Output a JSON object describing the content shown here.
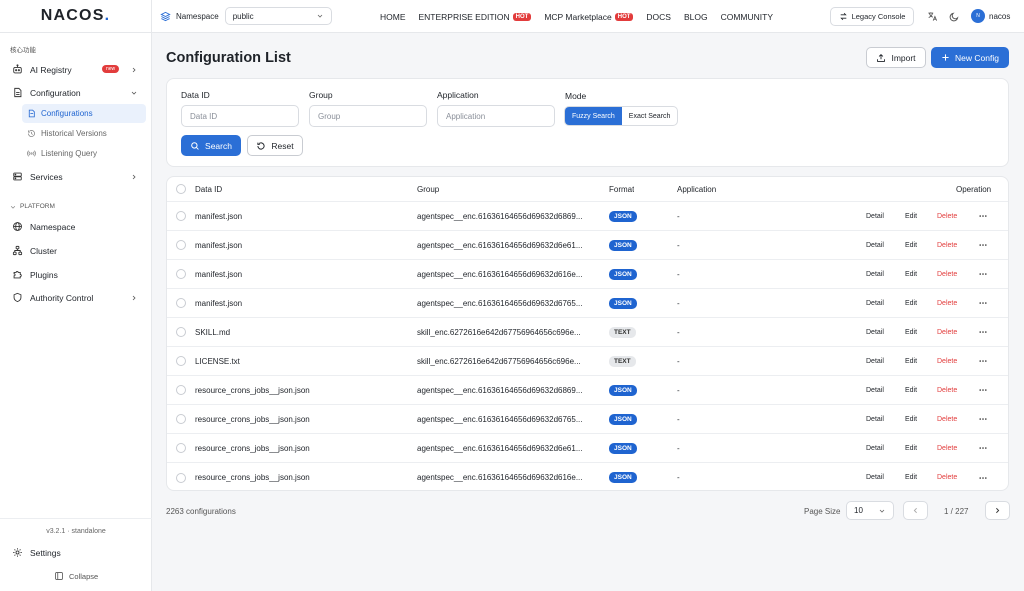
{
  "header": {
    "logo_text": "NACOS",
    "logo_dot": ".",
    "namespace_label": "Namespace",
    "namespace_value": "public",
    "nav": [
      {
        "label": "HOME",
        "hot": ""
      },
      {
        "label": "ENTERPRISE EDITION",
        "hot": "HOT"
      },
      {
        "label": "MCP Marketplace",
        "hot": "HOT"
      },
      {
        "label": "DOCS",
        "hot": ""
      },
      {
        "label": "BLOG",
        "hot": ""
      },
      {
        "label": "COMMUNITY",
        "hot": ""
      }
    ],
    "legacy_console": "Legacy Console",
    "avatar_initial": "N",
    "username": "nacos"
  },
  "sidebar": {
    "section_core": "核心功能",
    "ai_registry": "AI Registry",
    "ai_registry_badge": "new",
    "configuration": "Configuration",
    "configurations": "Configurations",
    "historical_versions": "Historical Versions",
    "listening_query": "Listening Query",
    "services": "Services",
    "section_platform": "PLATFORM",
    "namespace": "Namespace",
    "cluster": "Cluster",
    "plugins": "Plugins",
    "authority_control": "Authority Control",
    "version": "v3.2.1 · standalone",
    "settings": "Settings",
    "collapse": "Collapse"
  },
  "main": {
    "title": "Configuration List",
    "import_label": "Import",
    "new_config_label": "New Config"
  },
  "filters": {
    "data_id_label": "Data ID",
    "data_id_placeholder": "Data ID",
    "group_label": "Group",
    "group_placeholder": "Group",
    "application_label": "Application",
    "application_placeholder": "Application",
    "mode_label": "Mode",
    "fuzzy_search": "Fuzzy Search",
    "exact_search": "Exact Search",
    "search_label": "Search",
    "reset_label": "Reset"
  },
  "table": {
    "headers": {
      "data_id": "Data ID",
      "group": "Group",
      "format": "Format",
      "application": "Application",
      "operation": "Operation"
    },
    "operations": {
      "detail": "Detail",
      "edit": "Edit",
      "delete": "Delete"
    },
    "rows": [
      {
        "data_id": "manifest.json",
        "group": "agentspec__enc.61636164656d69632d6869...",
        "format": "JSON",
        "application": "-"
      },
      {
        "data_id": "manifest.json",
        "group": "agentspec__enc.61636164656d69632d6e61...",
        "format": "JSON",
        "application": "-"
      },
      {
        "data_id": "manifest.json",
        "group": "agentspec__enc.61636164656d69632d616e...",
        "format": "JSON",
        "application": "-"
      },
      {
        "data_id": "manifest.json",
        "group": "agentspec__enc.61636164656d69632d6765...",
        "format": "JSON",
        "application": "-"
      },
      {
        "data_id": "SKILL.md",
        "group": "skill_enc.6272616e642d67756964656c696e...",
        "format": "TEXT",
        "application": "-"
      },
      {
        "data_id": "LICENSE.txt",
        "group": "skill_enc.6272616e642d67756964656c696e...",
        "format": "TEXT",
        "application": "-"
      },
      {
        "data_id": "resource_crons_jobs__json.json",
        "group": "agentspec__enc.61636164656d69632d6869...",
        "format": "JSON",
        "application": "-"
      },
      {
        "data_id": "resource_crons_jobs__json.json",
        "group": "agentspec__enc.61636164656d69632d6765...",
        "format": "JSON",
        "application": "-"
      },
      {
        "data_id": "resource_crons_jobs__json.json",
        "group": "agentspec__enc.61636164656d69632d6e61...",
        "format": "JSON",
        "application": "-"
      },
      {
        "data_id": "resource_crons_jobs__json.json",
        "group": "agentspec__enc.61636164656d69632d616e...",
        "format": "JSON",
        "application": "-"
      }
    ]
  },
  "pagination": {
    "total": "2263 configurations",
    "page_size_label": "Page Size",
    "page_size": "10",
    "page_info": "1 / 227"
  },
  "colors": {
    "accent": "#2b6fd6",
    "danger": "#e23c3c"
  }
}
